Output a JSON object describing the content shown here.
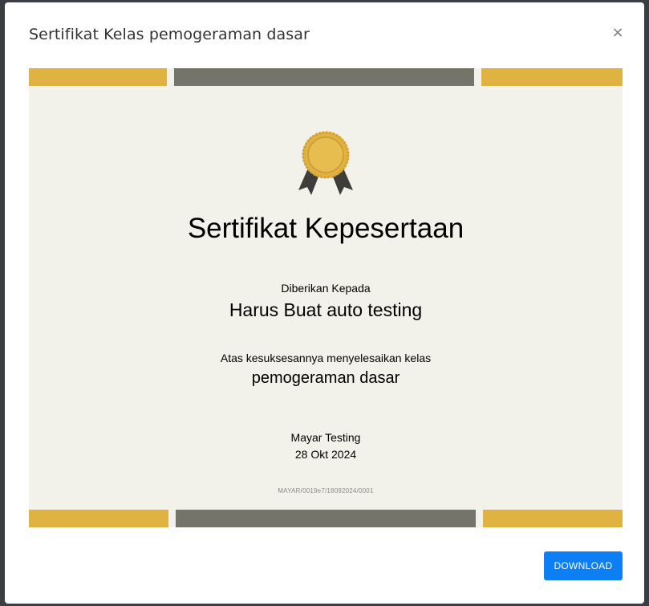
{
  "modal": {
    "title": "Sertifikat Kelas pemogeraman dasar",
    "close_label": "×"
  },
  "certificate": {
    "heading": "Sertifikat Kepesertaan",
    "given_to_label": "Diberikan Kepada",
    "recipient_name": "Harus Buat auto testing",
    "success_text": "Atas kesuksesannya menyelesaikan kelas",
    "class_name": "pemogeraman dasar",
    "issuer": "Mayar Testing",
    "date": "28 Okt 2024",
    "code": "MAYAR/0019e7/18092024/0001",
    "badge_icon": "award-ribbon-icon"
  },
  "colors": {
    "gold": "#e0b241",
    "gray": "#74746b",
    "background": "#f2f2ea",
    "button": "#0d7ff5"
  },
  "footer": {
    "download_label": "DOWNLOAD"
  }
}
